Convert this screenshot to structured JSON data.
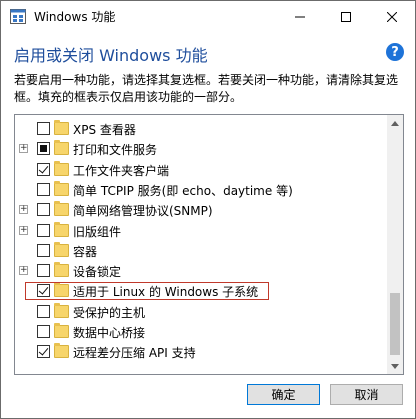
{
  "window": {
    "title": "Windows 功能"
  },
  "header": {
    "heading": "启用或关闭 Windows 功能",
    "help_glyph": "?",
    "description": "若要启用一种功能，请选择其复选框。若要关闭一种功能，请清除其复选框。填充的框表示仅启用该功能的一部分。"
  },
  "features": [
    {
      "label": "XPS 查看器",
      "state": "unchecked",
      "expandable": false
    },
    {
      "label": "打印和文件服务",
      "state": "partial",
      "expandable": true
    },
    {
      "label": "工作文件夹客户端",
      "state": "checked",
      "expandable": false
    },
    {
      "label": "简单 TCPIP 服务(即 echo、daytime 等)",
      "state": "unchecked",
      "expandable": false
    },
    {
      "label": "简单网络管理协议(SNMP)",
      "state": "unchecked",
      "expandable": true
    },
    {
      "label": "旧版组件",
      "state": "unchecked",
      "expandable": true
    },
    {
      "label": "容器",
      "state": "unchecked",
      "expandable": false
    },
    {
      "label": "设备锁定",
      "state": "unchecked",
      "expandable": true
    },
    {
      "label": "适用于 Linux 的 Windows 子系统",
      "state": "checked",
      "expandable": false,
      "highlighted": true
    },
    {
      "label": "受保护的主机",
      "state": "unchecked",
      "expandable": false
    },
    {
      "label": "数据中心桥接",
      "state": "unchecked",
      "expandable": false
    },
    {
      "label": "远程差分压缩 API 支持",
      "state": "checked",
      "expandable": false
    }
  ],
  "buttons": {
    "ok": "确定",
    "cancel": "取消"
  },
  "colors": {
    "heading": "#1f4e9c",
    "help": "#1e73d8",
    "highlight": "#c0392b",
    "folder": "#f7d56b"
  },
  "icons": {
    "window": "windows-features-icon",
    "help": "help-icon",
    "folder": "folder-icon"
  }
}
